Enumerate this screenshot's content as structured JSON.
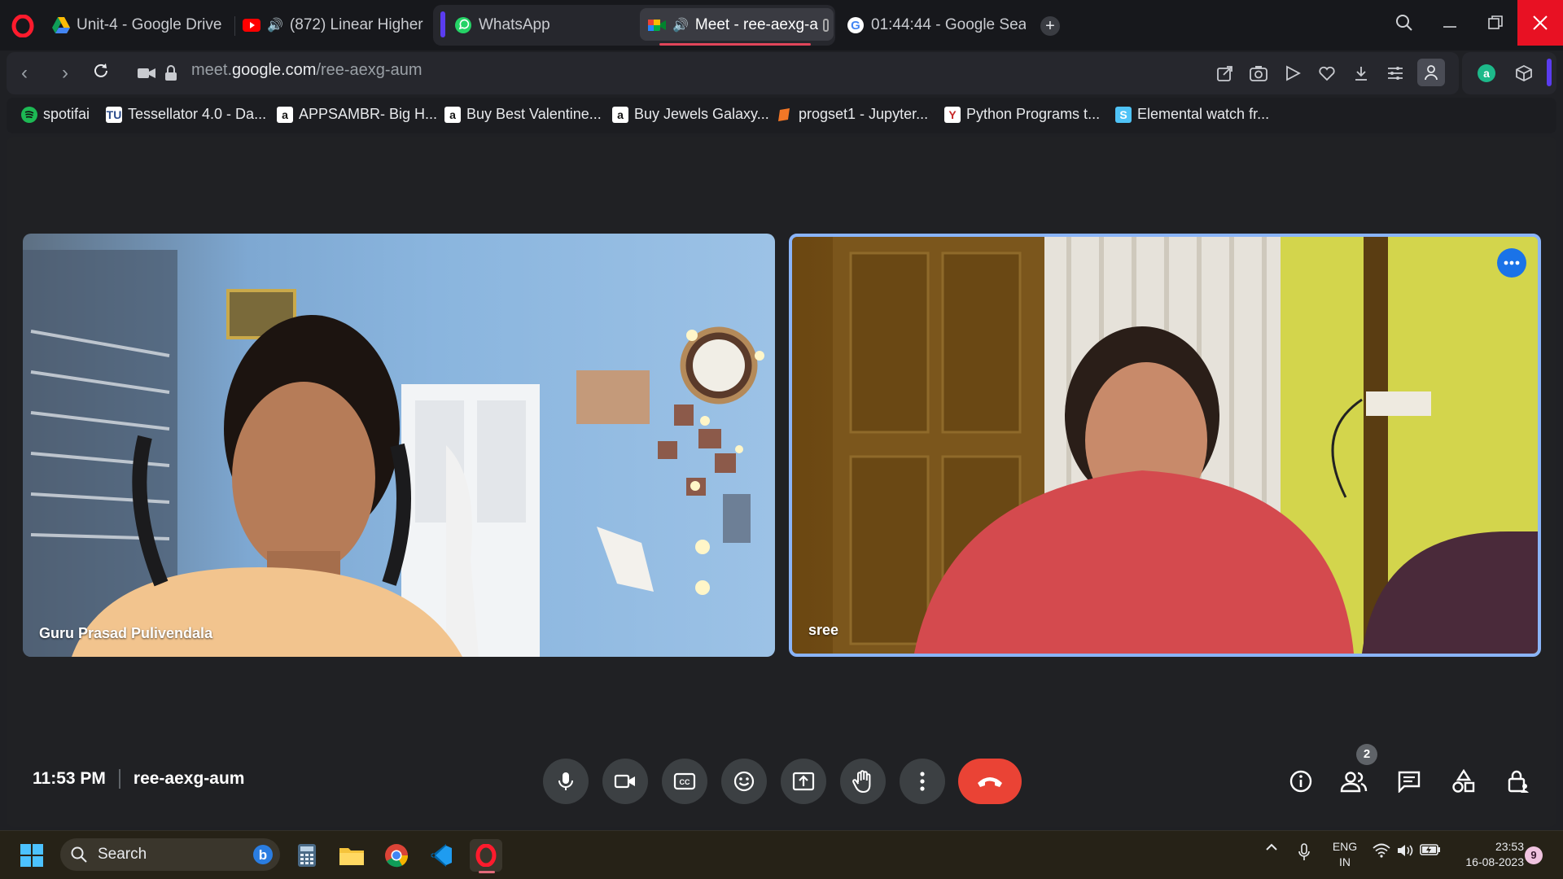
{
  "browser": {
    "tabs": [
      {
        "label": "Unit-4 - Google Drive",
        "icon": "google-drive-icon"
      },
      {
        "label": "(872) Linear Higher (",
        "icon": "youtube-icon",
        "audio": true
      },
      {
        "label": "WhatsApp",
        "icon": "whatsapp-icon"
      },
      {
        "label": "Meet - ree-aexg-a",
        "icon": "google-meet-icon",
        "audio": true,
        "active": true
      },
      {
        "label": "01:44:44 - Google Searc",
        "icon": "google-icon"
      }
    ],
    "address": {
      "prefix": "meet.",
      "domain": "google.com",
      "path": "/ree-aexg-aum"
    },
    "bookmarks": [
      {
        "label": "spotifai",
        "icon": "spotify-icon",
        "color": "#1db954"
      },
      {
        "label": "Tessellator 4.0 - Da...",
        "icon": "tessellator-icon",
        "color": "#ffffff"
      },
      {
        "label": "APPSAMBR- Big H...",
        "icon": "amazon-icon",
        "color": "#ffffff"
      },
      {
        "label": "Buy Best Valentine...",
        "icon": "amazon-icon",
        "color": "#ffffff"
      },
      {
        "label": "Buy Jewels Galaxy...",
        "icon": "amazon-icon",
        "color": "#ffffff"
      },
      {
        "label": "progset1 - Jupyter...",
        "icon": "jupyter-icon",
        "color": "#f37726"
      },
      {
        "label": "Python Programs t...",
        "icon": "python-programs-icon",
        "color": "#ffffff"
      },
      {
        "label": "Elemental watch fr...",
        "icon": "elemental-icon",
        "color": "#4fc3f7"
      }
    ]
  },
  "meet": {
    "participants": [
      {
        "name": "Guru Prasad Pulivendala"
      },
      {
        "name": "sree"
      }
    ],
    "time": "11:53 PM",
    "meeting_code": "ree-aexg-aum",
    "people_count": "2",
    "accent": "#8ab4f8",
    "end_call_color": "#ea4335"
  },
  "taskbar": {
    "search_label": "Search",
    "language": "ENG",
    "region": "IN",
    "clock_time": "23:53",
    "clock_date": "16-08-2023",
    "notification_count": "9"
  }
}
